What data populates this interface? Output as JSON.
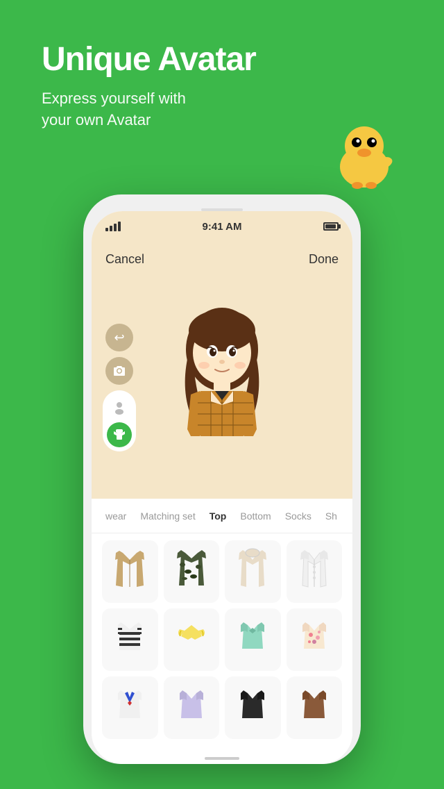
{
  "hero": {
    "title": "Unique Avatar",
    "subtitle": "Express yourself with\nyour own Avatar"
  },
  "phone": {
    "status": {
      "time": "9:41 AM"
    },
    "nav": {
      "cancel": "Cancel",
      "done": "Done"
    },
    "categories": [
      {
        "id": "outerwear",
        "label": "wear",
        "active": false
      },
      {
        "id": "matching",
        "label": "Matching set",
        "active": false
      },
      {
        "id": "top",
        "label": "Top",
        "active": true
      },
      {
        "id": "bottom",
        "label": "Bottom",
        "active": false
      },
      {
        "id": "socks",
        "label": "Socks",
        "active": false
      },
      {
        "id": "shoes",
        "label": "Sh",
        "active": false
      }
    ],
    "controls": {
      "undo_icon": "↩",
      "camera_icon": "📷",
      "face_icon": "👤",
      "outfit_icon": "👕"
    }
  },
  "colors": {
    "green": "#3cb84a",
    "avatar_bg": "#f5e6c8",
    "active_tab": "#333333",
    "inactive_tab": "#999999"
  }
}
